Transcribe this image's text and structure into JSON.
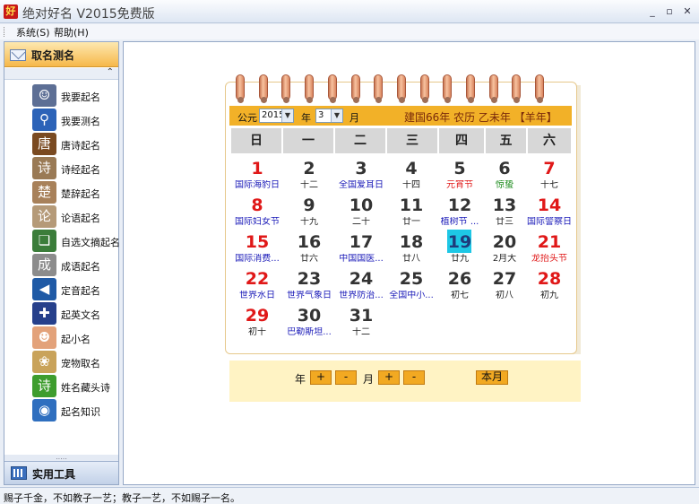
{
  "window": {
    "app_icon_text": "好",
    "title": "绝对好名 V2015免费版",
    "minimize": "_",
    "maximize": "▫",
    "close": "✕"
  },
  "menu": {
    "items": [
      "系统(S)",
      "帮助(H)"
    ]
  },
  "sidebar": {
    "header": "取名测名",
    "collapse": "⌃",
    "items": [
      {
        "label": "我要起名",
        "icon": "person-icon",
        "glyph": "☺",
        "color": "#5d6f95"
      },
      {
        "label": "我要测名",
        "icon": "magnifier-icon",
        "glyph": "⚲",
        "color": "#2c63b8"
      },
      {
        "label": "唐诗起名",
        "icon": "tang-scroll-icon",
        "glyph": "唐",
        "color": "#7a4a21"
      },
      {
        "label": "诗经起名",
        "icon": "book-icon",
        "glyph": "诗",
        "color": "#9a7a55"
      },
      {
        "label": "楚辞起名",
        "icon": "scroll-icon",
        "glyph": "楚",
        "color": "#a8815a"
      },
      {
        "label": "论语起名",
        "icon": "calligraphy-icon",
        "glyph": "论",
        "color": "#b59a78"
      },
      {
        "label": "自选文摘起名",
        "icon": "books-stack-icon",
        "glyph": "❏",
        "color": "#3b7d3a"
      },
      {
        "label": "成语起名",
        "icon": "painting-icon",
        "glyph": "成",
        "color": "#8c8c8c"
      },
      {
        "label": "定音起名",
        "icon": "speaker-icon",
        "glyph": "◀",
        "color": "#1f5aa6"
      },
      {
        "label": "起英文名",
        "icon": "uk-flag-icon",
        "glyph": "✚",
        "color": "#26408b"
      },
      {
        "label": "起小名",
        "icon": "baby-icon",
        "glyph": "☻",
        "color": "#e3a27a"
      },
      {
        "label": "宠物取名",
        "icon": "dog-icon",
        "glyph": "❀",
        "color": "#c9a35a"
      },
      {
        "label": "姓名藏头诗",
        "icon": "poem-icon",
        "glyph": "诗",
        "color": "#3e9d2e"
      },
      {
        "label": "起名知识",
        "icon": "globe-icon",
        "glyph": "◉",
        "color": "#2f6fbf"
      }
    ],
    "footer": "实用工具",
    "grip": "....."
  },
  "calendar": {
    "era_label": "公元",
    "year_value": "2015",
    "year_unit": "年",
    "month_value": "3",
    "month_unit": "月",
    "info": "建国66年 农历 乙未年 【羊年】",
    "weekdays": [
      "日",
      "一",
      "二",
      "三",
      "四",
      "五",
      "六"
    ],
    "days": [
      {
        "n": "1",
        "sub": "国际海豹日",
        "red": true,
        "sub_color": "blue"
      },
      {
        "n": "2",
        "sub": "十二",
        "red": false,
        "sub_color": "black"
      },
      {
        "n": "3",
        "sub": "全国爱耳日",
        "red": false,
        "sub_color": "blue"
      },
      {
        "n": "4",
        "sub": "十四",
        "red": false,
        "sub_color": "black"
      },
      {
        "n": "5",
        "sub": "元宵节",
        "red": false,
        "sub_color": "red"
      },
      {
        "n": "6",
        "sub": "惊蛰",
        "red": false,
        "sub_color": "green"
      },
      {
        "n": "7",
        "sub": "十七",
        "red": true,
        "sub_color": "black"
      },
      {
        "n": "8",
        "sub": "国际妇女节",
        "red": true,
        "sub_color": "blue"
      },
      {
        "n": "9",
        "sub": "十九",
        "red": false,
        "sub_color": "black"
      },
      {
        "n": "10",
        "sub": "二十",
        "red": false,
        "sub_color": "black"
      },
      {
        "n": "11",
        "sub": "廿一",
        "red": false,
        "sub_color": "black"
      },
      {
        "n": "12",
        "sub": "植树节 ...",
        "red": false,
        "sub_color": "blue"
      },
      {
        "n": "13",
        "sub": "廿三",
        "red": false,
        "sub_color": "black"
      },
      {
        "n": "14",
        "sub": "国际警察日",
        "red": true,
        "sub_color": "blue"
      },
      {
        "n": "15",
        "sub": "国际消费...",
        "red": true,
        "sub_color": "blue"
      },
      {
        "n": "16",
        "sub": "廿六",
        "red": false,
        "sub_color": "black"
      },
      {
        "n": "17",
        "sub": "中国国医...",
        "red": false,
        "sub_color": "blue"
      },
      {
        "n": "18",
        "sub": "廿八",
        "red": false,
        "sub_color": "black"
      },
      {
        "n": "19",
        "sub": "廿九",
        "red": false,
        "sub_color": "black",
        "today": true
      },
      {
        "n": "20",
        "sub": "2月大",
        "red": false,
        "sub_color": "black"
      },
      {
        "n": "21",
        "sub": "龙抬头节",
        "red": true,
        "sub_color": "red"
      },
      {
        "n": "22",
        "sub": "世界水日",
        "red": true,
        "sub_color": "blue"
      },
      {
        "n": "23",
        "sub": "世界气象日",
        "red": false,
        "sub_color": "blue"
      },
      {
        "n": "24",
        "sub": "世界防治...",
        "red": false,
        "sub_color": "blue"
      },
      {
        "n": "25",
        "sub": "全国中小...",
        "red": false,
        "sub_color": "blue"
      },
      {
        "n": "26",
        "sub": "初七",
        "red": false,
        "sub_color": "black"
      },
      {
        "n": "27",
        "sub": "初八",
        "red": false,
        "sub_color": "black"
      },
      {
        "n": "28",
        "sub": "初九",
        "red": true,
        "sub_color": "black"
      },
      {
        "n": "29",
        "sub": "初十",
        "red": true,
        "sub_color": "black"
      },
      {
        "n": "30",
        "sub": "巴勒斯坦...",
        "red": false,
        "sub_color": "blue"
      },
      {
        "n": "31",
        "sub": "十二",
        "red": false,
        "sub_color": "black"
      }
    ],
    "footer": {
      "year_label": "年",
      "month_label": "月",
      "plus": "+",
      "minus": "-",
      "this_month": "本月"
    }
  },
  "status": "赐子千金，不如教子一艺；教子一艺，不如赐子一名。",
  "colors": {
    "accent_orange": "#f2b128",
    "today": "#1ec7e5",
    "red_day": "#e01818",
    "blue_text": "#1a1ab8",
    "green_text": "#1a8a1a"
  }
}
